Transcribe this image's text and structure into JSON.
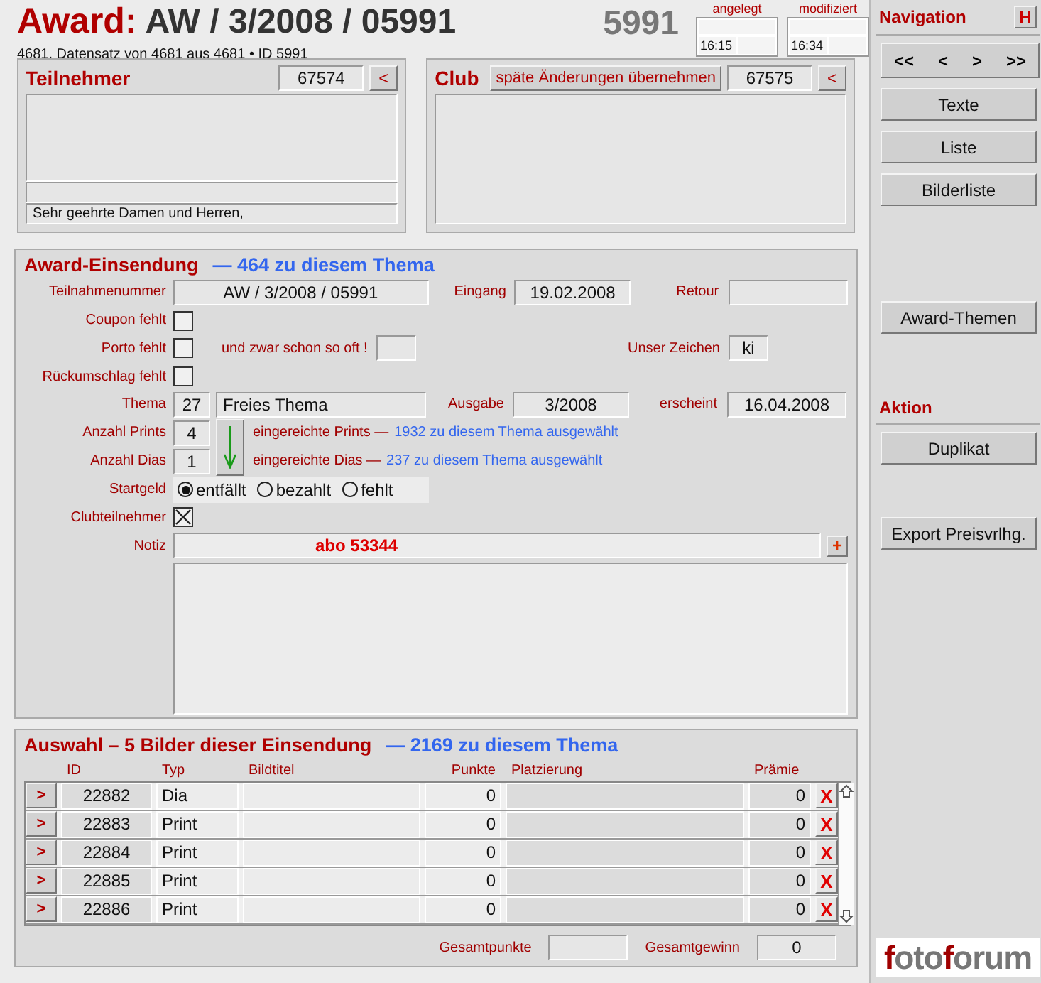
{
  "header": {
    "title_prefix": "Award:",
    "title": "AW / 3/2008 / 05991",
    "record_number": "5991",
    "record_info": "4681. Datensatz von 4681 aus 4681 • ID 5991",
    "timestamps": [
      {
        "label": "angelegt",
        "time": "16:15"
      },
      {
        "label": "modifiziert",
        "time": "16:34"
      }
    ]
  },
  "teilnehmer": {
    "title": "Teilnehmer",
    "number": "67574",
    "link_button": "<",
    "salutation": "Sehr geehrte Damen und Herren,"
  },
  "club": {
    "title": "Club",
    "action_button": "späte Änderungen übernehmen",
    "number": "67575",
    "link_button": "<"
  },
  "submission": {
    "title": "Award-Einsendung",
    "count_note": "— 464 zu diesem Thema",
    "teilnahmenummer": {
      "label": "Teilnahmenummer",
      "value": "AW / 3/2008 / 05991"
    },
    "eingang": {
      "label": "Eingang",
      "value": "19.02.2008"
    },
    "retour": {
      "label": "Retour"
    },
    "checks": [
      {
        "label": "Coupon fehlt",
        "checked": false
      },
      {
        "label": "Porto fehlt",
        "checked": false
      },
      {
        "label": "Rückumschlag fehlt",
        "checked": false
      }
    ],
    "porto_note": "und zwar schon so oft !",
    "unser_zeichen": {
      "label": "Unser Zeichen",
      "value": "ki"
    },
    "thema": {
      "label": "Thema",
      "number": "27",
      "name": "Freies Thema"
    },
    "ausgabe": {
      "label": "Ausgabe",
      "value": "3/2008"
    },
    "erscheint": {
      "label": "erscheint",
      "value": "16.04.2008"
    },
    "counts": [
      {
        "label": "Anzahl Prints",
        "value": "4",
        "note": "eingereichte Prints —",
        "total": "1932 zu diesem Thema ausgewählt"
      },
      {
        "label": "Anzahl Dias",
        "value": "1",
        "note": "eingereichte Dias —",
        "total": "237 zu diesem Thema ausgewählt"
      }
    ],
    "startgeld": {
      "label": "Startgeld",
      "options": [
        {
          "label": "entfällt",
          "selected": true
        },
        {
          "label": "bezahlt",
          "selected": false
        },
        {
          "label": "fehlt",
          "selected": false
        }
      ]
    },
    "clubteilnehmer": {
      "label": "Clubteilnehmer",
      "checked": true
    },
    "notiz": {
      "label": "Notiz",
      "value": "abo 53344",
      "add_button": "+"
    }
  },
  "selection": {
    "title": "Auswahl – 5 Bilder dieser Einsendung",
    "count_note": "— 2169 zu diesem Thema",
    "columns": [
      "ID",
      "Typ",
      "Bildtitel",
      "Punkte",
      "Platzierung",
      "Prämie"
    ],
    "rows": [
      {
        "open": ">",
        "id": "22882",
        "type": "Dia",
        "punkte": "0",
        "praemie": "0",
        "delete": "X"
      },
      {
        "open": ">",
        "id": "22883",
        "type": "Print",
        "punkte": "0",
        "praemie": "0",
        "delete": "X"
      },
      {
        "open": ">",
        "id": "22884",
        "type": "Print",
        "punkte": "0",
        "praemie": "0",
        "delete": "X"
      },
      {
        "open": ">",
        "id": "22885",
        "type": "Print",
        "punkte": "0",
        "praemie": "0",
        "delete": "X"
      },
      {
        "open": ">",
        "id": "22886",
        "type": "Print",
        "punkte": "0",
        "praemie": "0",
        "delete": "X"
      }
    ],
    "totals": [
      {
        "label": "Gesamtpunkte"
      },
      {
        "label": "Gesamtgewinn",
        "value": "0"
      }
    ]
  },
  "sidebar": {
    "navigation": {
      "title": "Navigation",
      "help_button": "H",
      "arrows": [
        "<<",
        "<",
        ">",
        ">>"
      ],
      "buttons": [
        "Texte",
        "Liste",
        "Bilderliste"
      ],
      "extra_button": "Award-Themen"
    },
    "aktion": {
      "title": "Aktion",
      "buttons": [
        "Duplikat",
        "Export Preisvrlhg."
      ]
    },
    "logo": [
      {
        "text": "f",
        "accent": true
      },
      {
        "text": "oto",
        "accent": false
      },
      {
        "text": "f",
        "accent": true
      },
      {
        "text": "orum",
        "accent": false
      }
    ]
  }
}
